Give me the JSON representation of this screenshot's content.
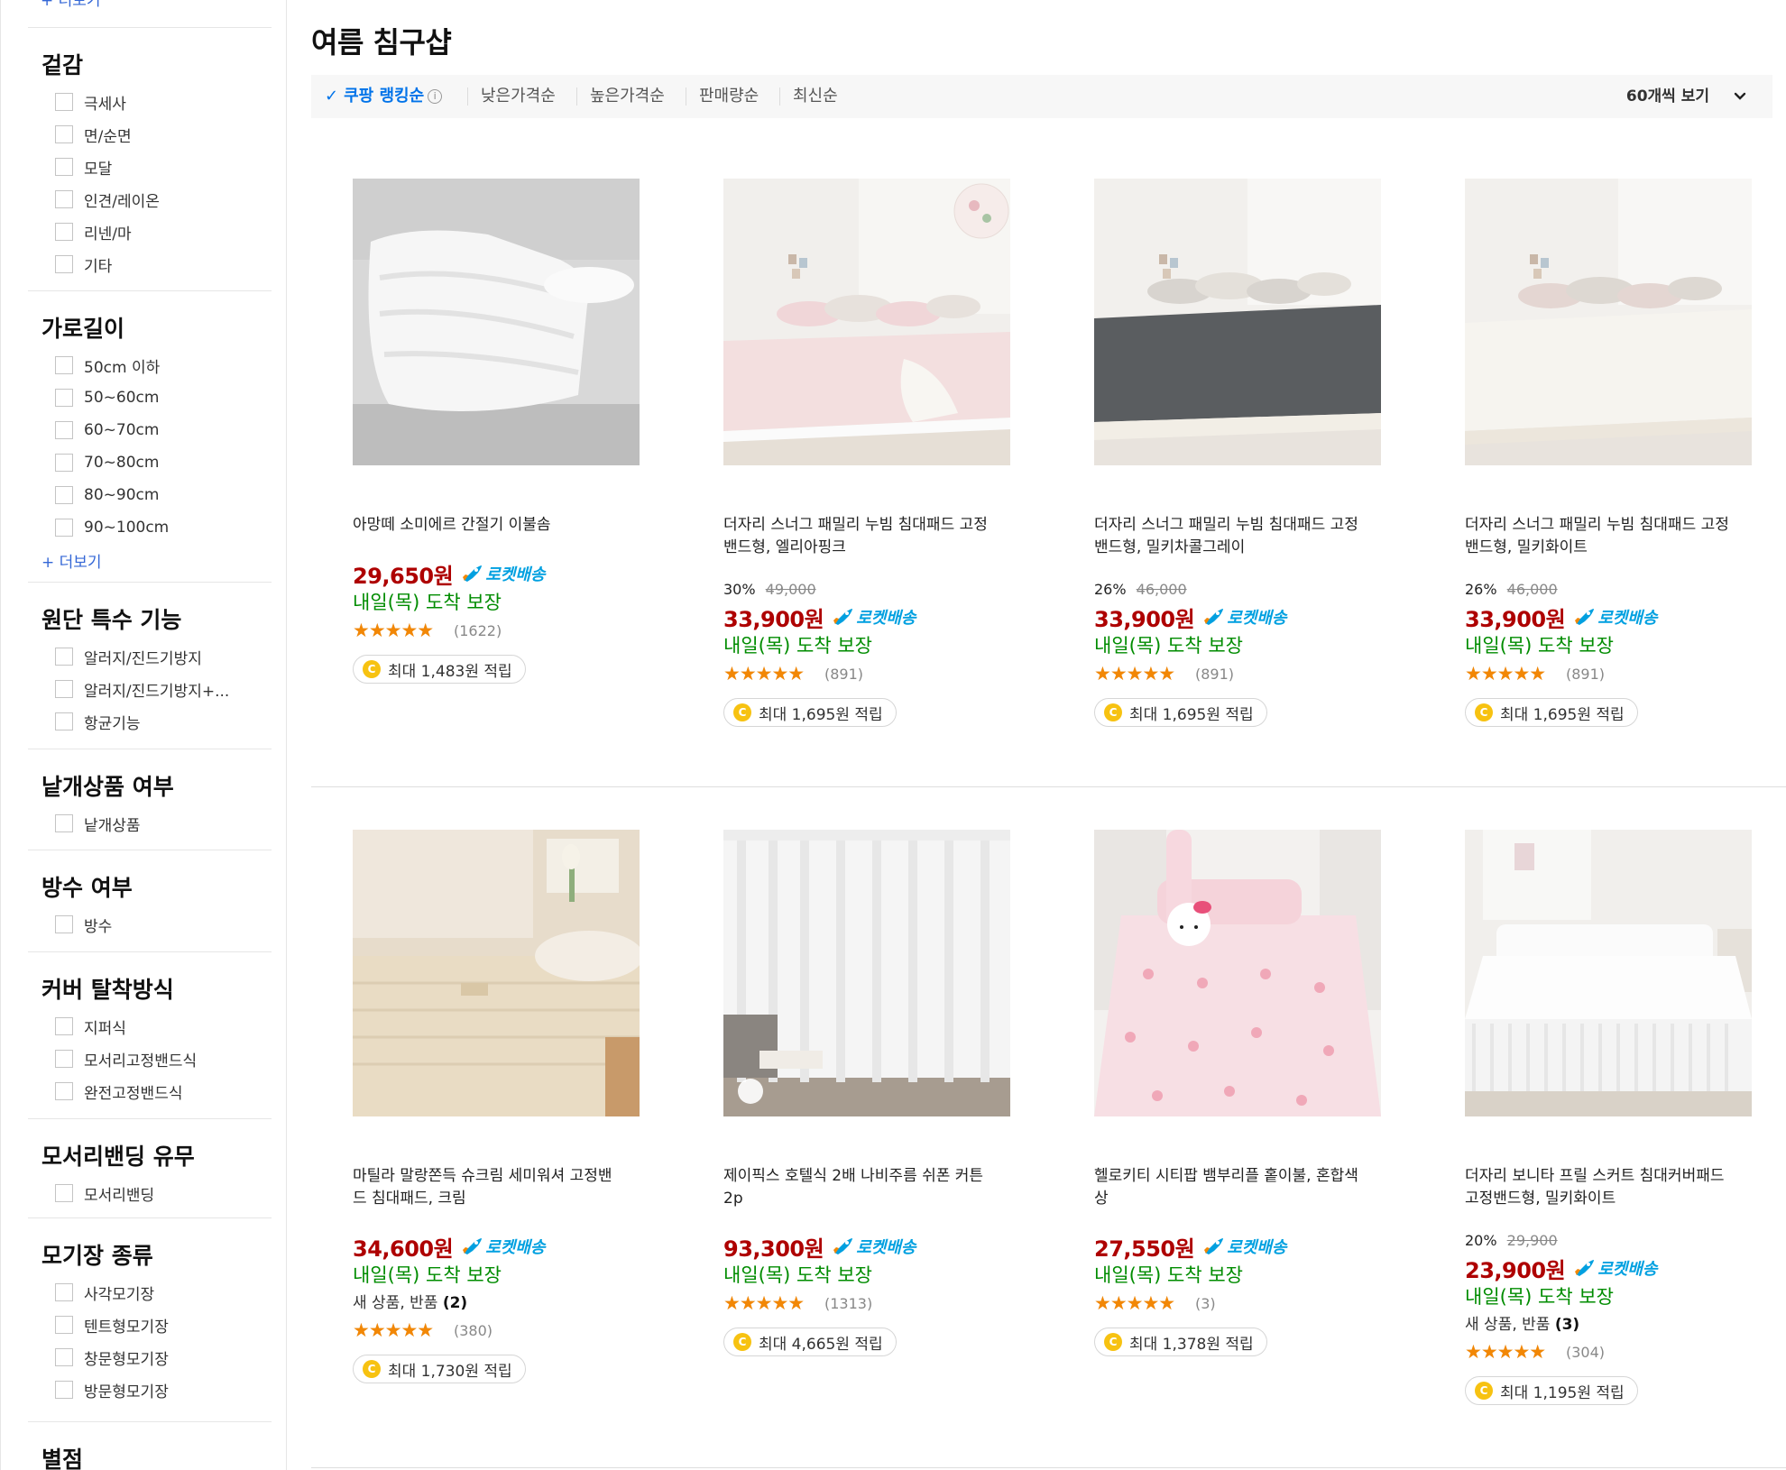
{
  "sidebar": {
    "top_more": "+ 더보기",
    "sections": [
      {
        "title": "겉감",
        "options": [
          "극세사",
          "면/순면",
          "모달",
          "인견/레이온",
          "리넨/마",
          "기타"
        ],
        "more": ""
      },
      {
        "title": "가로길이",
        "options": [
          "50cm 이하",
          "50~60cm",
          "60~70cm",
          "70~80cm",
          "80~90cm",
          "90~100cm"
        ],
        "more": "+ 더보기"
      },
      {
        "title": "원단 특수 기능",
        "options": [
          "알러지/진드기방지",
          "알러지/진드기방지+...",
          "항균기능"
        ],
        "more": ""
      },
      {
        "title": "낱개상품 여부",
        "options": [
          "낱개상품"
        ],
        "more": ""
      },
      {
        "title": "방수 여부",
        "options": [
          "방수"
        ],
        "more": ""
      },
      {
        "title": "커버 탈착방식",
        "options": [
          "지퍼식",
          "모서리고정밴드식",
          "완전고정밴드식"
        ],
        "more": ""
      },
      {
        "title": "모서리밴딩 유무",
        "options": [
          "모서리밴딩"
        ],
        "more": ""
      },
      {
        "title": "모기장 종류",
        "options": [
          "사각모기장",
          "텐트형모기장",
          "창문형모기장",
          "방문형모기장"
        ],
        "more": ""
      },
      {
        "title": "별점",
        "options": [],
        "more": ""
      }
    ]
  },
  "page": {
    "title": "여름 침구샵"
  },
  "sortbar": {
    "items": [
      "쿠팡 랭킹순",
      "낮은가격순",
      "높은가격순",
      "판매량순",
      "최신순"
    ],
    "active_index": 0,
    "per_page": "60개씩 보기"
  },
  "labels": {
    "rocket": "로켓배송"
  },
  "colors": {
    "price": "#ae0000",
    "rocket": "#00a0e0",
    "arrival": "#008c00",
    "active_sort": "#0073e9",
    "star": "#f28705",
    "coin": "#f7c211"
  },
  "products": [
    {
      "name": "아망떼 소미에르 간절기 이불솜",
      "discount": "",
      "original_price": "",
      "price": "29,650원",
      "arrival": "내일(목) 도착 보장",
      "new_product": "",
      "new_count": "",
      "rating": 4.5,
      "review_count": "(1622)",
      "reward": "최대 1,483원 적립",
      "image": "white-duvet"
    },
    {
      "name": "더자리 스너그 패밀리 누빔 침대패드 고정밴드형, 엘리아핑크",
      "discount": "30%",
      "original_price": "49,000",
      "price": "33,900원",
      "arrival": "내일(목) 도착 보장",
      "new_product": "",
      "new_count": "",
      "rating": 4.5,
      "review_count": "(891)",
      "reward": "최대 1,695원 적립",
      "image": "pink-pad-floor"
    },
    {
      "name": "더자리 스너그 패밀리 누빔 침대패드 고정밴드형, 밀키차콜그레이",
      "discount": "26%",
      "original_price": "46,000",
      "price": "33,900원",
      "arrival": "내일(목) 도착 보장",
      "new_product": "",
      "new_count": "",
      "rating": 4.5,
      "review_count": "(891)",
      "reward": "최대 1,695원 적립",
      "image": "charcoal-pad-floor"
    },
    {
      "name": "더자리 스너그 패밀리 누빔 침대패드 고정밴드형, 밀키화이트",
      "discount": "26%",
      "original_price": "46,000",
      "price": "33,900원",
      "arrival": "내일(목) 도착 보장",
      "new_product": "",
      "new_count": "",
      "rating": 4.5,
      "review_count": "(891)",
      "reward": "최대 1,695원 적립",
      "image": "white-pad-floor"
    },
    {
      "name": "마틸라 말랑쫀득 슈크림 세미워셔 고정밴드 침대패드, 크림",
      "discount": "",
      "original_price": "",
      "price": "34,600원",
      "arrival": "내일(목) 도착 보장",
      "new_product": "새 상품, 반품",
      "new_count": "(2)",
      "rating": 4.5,
      "review_count": "(380)",
      "reward": "최대 1,730원 적립",
      "image": "cream-bed-pad"
    },
    {
      "name": "제이픽스 호텔식 2배 나비주름 쉬폰 커튼 2p",
      "discount": "",
      "original_price": "",
      "price": "93,300원",
      "arrival": "내일(목) 도착 보장",
      "new_product": "",
      "new_count": "",
      "rating": 4.5,
      "review_count": "(1313)",
      "reward": "최대 4,665원 적립",
      "image": "white-curtain"
    },
    {
      "name": "헬로키티 시티팝 뱀부리플 홑이불, 혼합색상",
      "discount": "",
      "original_price": "",
      "price": "27,550원",
      "arrival": "내일(목) 도착 보장",
      "new_product": "",
      "new_count": "",
      "rating": 5,
      "review_count": "(3)",
      "reward": "최대 1,378원 적립",
      "image": "hello-kitty-bedding"
    },
    {
      "name": "더자리 보니타 프릴 스커트 침대커버패드 고정밴드형, 밀키화이트",
      "discount": "20%",
      "original_price": "29,900",
      "price": "23,900원",
      "arrival": "내일(목) 도착 보장",
      "new_product": "새 상품, 반품",
      "new_count": "(3)",
      "rating": 4.5,
      "review_count": "(304)",
      "reward": "최대 1,195원 적립",
      "image": "frill-skirt-bed"
    }
  ]
}
